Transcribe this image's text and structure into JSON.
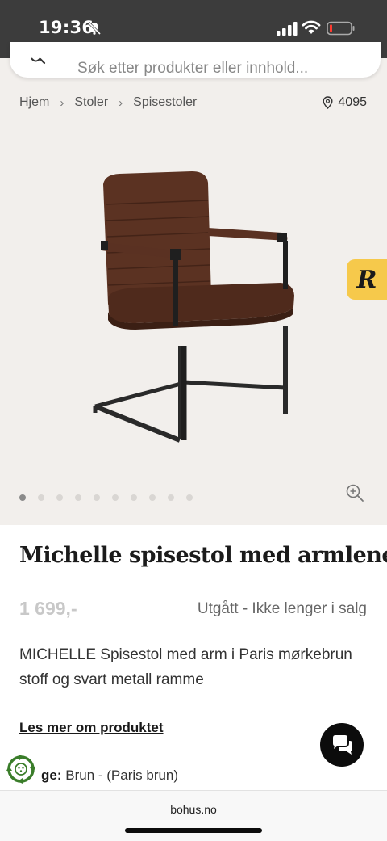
{
  "status_bar": {
    "time": "19:36"
  },
  "search": {
    "placeholder": "Søk etter produkter eller innhold..."
  },
  "breadcrumb": {
    "items": [
      "Hjem",
      "Stoler",
      "Spisestoler"
    ],
    "store_number": "4095"
  },
  "badge": {
    "letter": "R",
    "color": "#f6c94b"
  },
  "gallery": {
    "image_count": 10,
    "active_index": 0
  },
  "product": {
    "title": "Michelle spisestol med armlene",
    "price": "1 699,-",
    "status": "Utgått - Ikke lenger i salg",
    "description": "MICHELLE Spisestol med arm i Paris mørkebrun stoff og svart metall ramme",
    "read_more": "Les mer om produktet",
    "variant_label": "ge:",
    "variant_value": "Brun - (Paris brun)"
  },
  "browser": {
    "url": "bohus.no"
  },
  "icons": [
    "bell-muted-icon",
    "signal-icon",
    "wifi-icon",
    "battery-icon",
    "search-icon",
    "location-pin-icon",
    "chevron-right-icon",
    "zoom-in-icon",
    "chat-icon",
    "eco-icon"
  ]
}
